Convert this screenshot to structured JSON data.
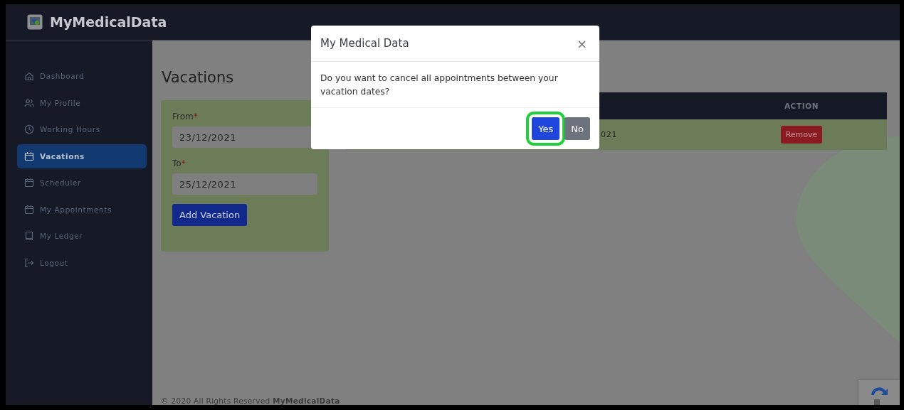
{
  "header": {
    "brand": "MyMedicalData"
  },
  "sidebar": {
    "items": [
      {
        "label": "Dashboard",
        "kind": "home",
        "selected": false
      },
      {
        "label": "My Profile",
        "kind": "people",
        "selected": false
      },
      {
        "label": "Working Hours",
        "kind": "clock",
        "selected": false
      },
      {
        "label": "Vacations",
        "kind": "calendar",
        "selected": true
      },
      {
        "label": "Scheduler",
        "kind": "calendar",
        "selected": false
      },
      {
        "label": "My Appointments",
        "kind": "calendar",
        "selected": false
      },
      {
        "label": "My Ledger",
        "kind": "book",
        "selected": false
      },
      {
        "label": "Logout",
        "kind": "logout",
        "selected": false
      }
    ]
  },
  "page": {
    "title": "Vacations",
    "form": {
      "fields": [
        {
          "label": "From",
          "mark": "*",
          "value": "23/12/2021"
        },
        {
          "label": "To",
          "mark": "*",
          "value": "25/12/2021"
        }
      ],
      "submit": "Add Vacation"
    },
    "table": {
      "columns": [
        {
          "label": "ACTION"
        }
      ],
      "rows": [
        {
          "cells": [
            "021"
          ],
          "action": "Remove"
        }
      ]
    }
  },
  "footer": "© 2020 All Rights Reserved **MyMedicalData**",
  "dialog": {
    "title": "My Medical Data",
    "close": "×",
    "message": "Do you want to cancel all appointments between your vacation dates?",
    "buttons": [
      {
        "label": "Yes",
        "kind": "primary",
        "highlighted": true
      },
      {
        "label": "No",
        "kind": "secondary",
        "highlighted": false
      }
    ]
  }
}
